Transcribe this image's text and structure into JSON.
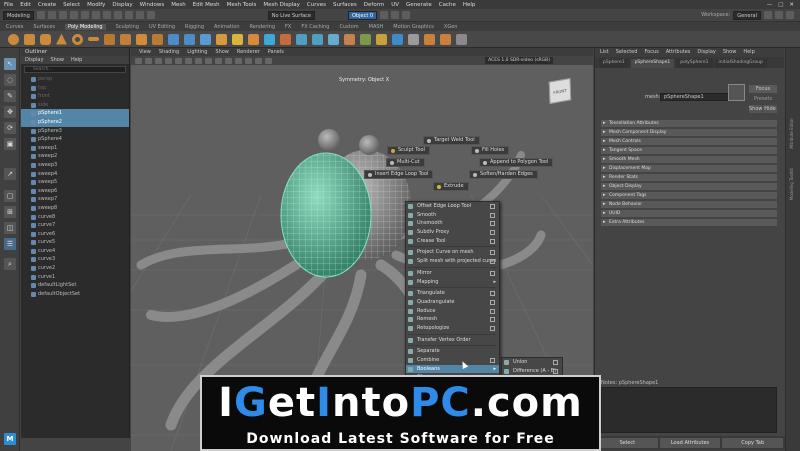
{
  "menubar": {
    "items": [
      "File",
      "Edit",
      "Create",
      "Select",
      "Modify",
      "Display",
      "Windows",
      "Mesh",
      "Edit Mesh",
      "Mesh Tools",
      "Mesh Display",
      "Curves",
      "Surfaces",
      "Deform",
      "UV",
      "Generate",
      "Cache",
      "Help"
    ],
    "workspace_label": "Workspace:",
    "workspace_value": "General"
  },
  "toolbar": {
    "mode_value": "Modeling",
    "live_surface": "No Live Surface",
    "object_field": "Object 0"
  },
  "shelf": {
    "tabs": [
      "Curves",
      "Surfaces",
      "Poly Modeling",
      "Sculpting",
      "UV Editing",
      "Rigging",
      "Animation",
      "Rendering",
      "FX",
      "FX Caching",
      "Custom",
      "MASH",
      "Motion Graphics",
      "XGen"
    ],
    "active_index": 2
  },
  "outliner": {
    "title": "Outliner",
    "menu": [
      "Display",
      "Show",
      "Help"
    ],
    "search_placeholder": "Search...",
    "items": [
      {
        "label": "persp",
        "state": "dim"
      },
      {
        "label": "top",
        "state": "dim"
      },
      {
        "label": "front",
        "state": "dim"
      },
      {
        "label": "side",
        "state": "dim"
      },
      {
        "label": "pSphere1",
        "state": "sel"
      },
      {
        "label": "pSphere2",
        "state": "sel"
      },
      {
        "label": "pSphere3",
        "state": ""
      },
      {
        "label": "pSphere4",
        "state": ""
      },
      {
        "label": "sweep1",
        "state": ""
      },
      {
        "label": "sweep2",
        "state": ""
      },
      {
        "label": "sweep3",
        "state": ""
      },
      {
        "label": "sweep4",
        "state": ""
      },
      {
        "label": "sweep5",
        "state": ""
      },
      {
        "label": "sweep6",
        "state": ""
      },
      {
        "label": "sweep7",
        "state": ""
      },
      {
        "label": "sweep8",
        "state": ""
      },
      {
        "label": "curve8",
        "state": ""
      },
      {
        "label": "curve7",
        "state": ""
      },
      {
        "label": "curve6",
        "state": ""
      },
      {
        "label": "curve5",
        "state": ""
      },
      {
        "label": "curve4",
        "state": ""
      },
      {
        "label": "curve3",
        "state": ""
      },
      {
        "label": "curve2",
        "state": ""
      },
      {
        "label": "curve1",
        "state": ""
      },
      {
        "label": "defaultLightSet",
        "state": ""
      },
      {
        "label": "defaultObjectSet",
        "state": ""
      }
    ]
  },
  "viewport": {
    "menu": [
      "View",
      "Shading",
      "Lighting",
      "Show",
      "Renderer",
      "Panels"
    ],
    "color_space": "ACES 1.0 SDR-video (sRGB)",
    "symmetry": "Symmetry: Object X",
    "viewcube_label": "FRONT",
    "marking_menu": {
      "target_weld": "Target Weld Tool",
      "sculpt": "Sculpt Tool",
      "fill_holes": "Fill Holes",
      "multi_cut": "Multi-Cut",
      "append_polygon": "Append to Polygon Tool",
      "insert_edge_loop": "Insert Edge Loop Tool",
      "soften_harden": "Soften/Harden Edges",
      "extrude": "Extrude"
    },
    "context_menu": [
      {
        "label": "Offset Edge Loop Tool",
        "box": true
      },
      {
        "label": "Smooth",
        "box": true
      },
      {
        "label": "Unsmooth",
        "box": true
      },
      {
        "label": "Subdiv Proxy",
        "box": true
      },
      {
        "label": "Crease Tool",
        "box": true
      },
      {
        "sep": true
      },
      {
        "label": "Project Curve on mesh",
        "box": true
      },
      {
        "label": "Split mesh with projected curve",
        "box": true
      },
      {
        "sep": true
      },
      {
        "label": "Mirror",
        "box": true
      },
      {
        "label": "Mapping",
        "arrow": true
      },
      {
        "sep": true
      },
      {
        "label": "Triangulate",
        "box": true
      },
      {
        "label": "Quadrangulate",
        "box": true
      },
      {
        "label": "Reduce",
        "box": true
      },
      {
        "label": "Remesh",
        "box": true
      },
      {
        "label": "Retopologize",
        "box": true
      },
      {
        "sep": true
      },
      {
        "label": "Transfer Vertex Order"
      },
      {
        "sep": true
      },
      {
        "label": "Separate"
      },
      {
        "label": "Combine",
        "box": true
      },
      {
        "label": "Booleans",
        "arrow": true,
        "hl": true
      },
      {
        "label": "Cleanup...",
        "box": true
      }
    ],
    "submenu": [
      {
        "label": "Union"
      },
      {
        "label": "Difference (A - B)"
      }
    ]
  },
  "attribute_editor": {
    "menu": [
      "List",
      "Selected",
      "Focus",
      "Attributes",
      "Display",
      "Show",
      "Help"
    ],
    "tabs": [
      "pSphere1",
      "pSphereShape1",
      "polySphere1",
      "initialShadingGroup"
    ],
    "active_tab": 1,
    "mesh_label": "mesh:",
    "mesh_value": "pSphereShape1",
    "focus_btn": "Focus",
    "presets_btn": "Presets",
    "show_btn": "Show",
    "hide_btn": "Hide",
    "sections": [
      "Tessellation Attributes",
      "Mesh Component Display",
      "Mesh Controls",
      "Tangent Space",
      "Smooth Mesh",
      "Displacement Map",
      "Render Stats",
      "Object Display",
      "Component Tags",
      "Node Behavior",
      "UUID",
      "Extra Attributes"
    ],
    "notes_label": "Notes: pSphereShape1",
    "bottom_buttons": [
      "Select",
      "Load Attributes",
      "Copy Tab"
    ],
    "side_tabs": [
      "Attribute Editor",
      "Modeling Toolkit"
    ]
  },
  "watermark": {
    "title_pre": "I",
    "title_b1": "G",
    "title_mid1": "et",
    "title_b2": "I",
    "title_mid2": "nto",
    "title_b3": "PC",
    "title_post": ".com",
    "subtitle": "Download Latest Software for Free"
  },
  "colors": {
    "selection": "#5285a6",
    "watermark_blue": "#2f8ae8",
    "mesh_green": "#5fb89a"
  }
}
